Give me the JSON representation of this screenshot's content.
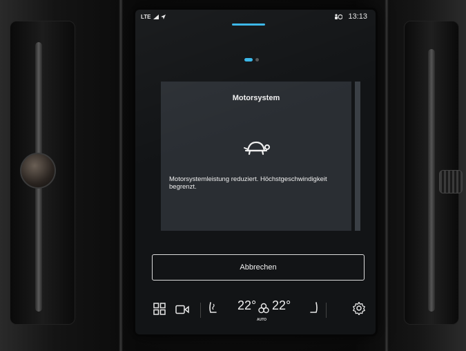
{
  "status_bar": {
    "network": "LTE",
    "time": "13:13"
  },
  "dialog": {
    "title": "Motorsystem",
    "message": "Motorsystemleistung reduziert. Höchstgeschwindigkeit begrenzt.",
    "icon": "turtle-icon"
  },
  "actions": {
    "cancel_label": "Abbrechen"
  },
  "climate": {
    "left_temp": "22°",
    "right_temp": "22°",
    "fan_mode": "AUTO"
  },
  "colors": {
    "accent": "#38b6e8",
    "dialog_bg": "#2a2e33",
    "screen_bg": "#121416"
  },
  "pagination": {
    "active_page": 1,
    "total_pages": 2
  }
}
